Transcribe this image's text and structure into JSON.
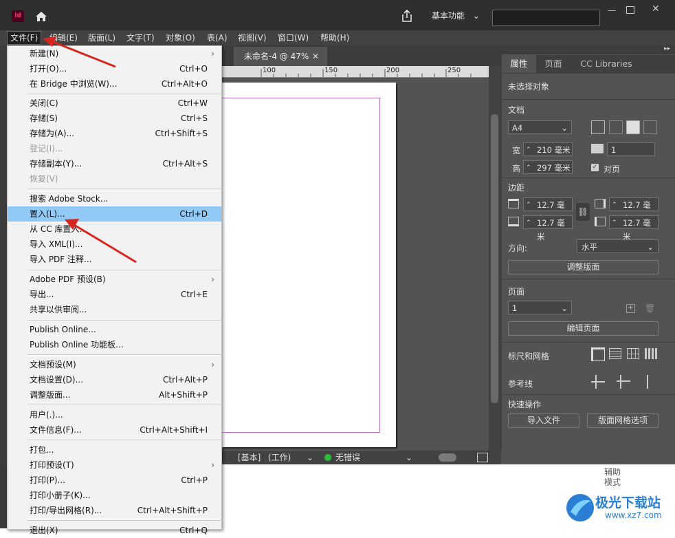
{
  "title_bar": {
    "app_logo": "Id",
    "workspace_label": "基本功能",
    "search_placeholder": ""
  },
  "menus": [
    "文件(F)",
    "编辑(E)",
    "版面(L)",
    "文字(T)",
    "对象(O)",
    "表(A)",
    "视图(V)",
    "窗口(W)",
    "帮助(H)"
  ],
  "file_menu": {
    "items": [
      {
        "label": "新建(N)",
        "shortcut": "",
        "submenu": true
      },
      {
        "label": "打开(O)...",
        "shortcut": "Ctrl+O"
      },
      {
        "label": "在 Bridge 中浏览(W)...",
        "shortcut": "Ctrl+Alt+O"
      },
      {
        "label": "关闭(C)",
        "shortcut": "Ctrl+W"
      },
      {
        "label": "存储(S)",
        "shortcut": "Ctrl+S"
      },
      {
        "label": "存储为(A)...",
        "shortcut": "Ctrl+Shift+S"
      },
      {
        "label": "登记(I)...",
        "shortcut": "",
        "disabled": true
      },
      {
        "label": "存储副本(Y)...",
        "shortcut": "Ctrl+Alt+S"
      },
      {
        "label": "恢复(V)",
        "shortcut": "",
        "disabled": true
      },
      {
        "label": "搜索 Adobe Stock...",
        "shortcut": ""
      },
      {
        "label": "置入(L)...",
        "shortcut": "Ctrl+D",
        "highlight": true
      },
      {
        "label": "从 CC 库置入...",
        "shortcut": ""
      },
      {
        "label": "导入 XML(I)...",
        "shortcut": ""
      },
      {
        "label": "导入 PDF 注释...",
        "shortcut": ""
      },
      {
        "label": "Adobe PDF 预设(B)",
        "shortcut": "",
        "submenu": true
      },
      {
        "label": "导出...",
        "shortcut": "Ctrl+E"
      },
      {
        "label": "共享以供审阅...",
        "shortcut": ""
      },
      {
        "label": "Publish Online...",
        "shortcut": ""
      },
      {
        "label": "Publish Online 功能板...",
        "shortcut": ""
      },
      {
        "label": "文档预设(M)",
        "shortcut": "",
        "submenu": true
      },
      {
        "label": "文档设置(D)...",
        "shortcut": "Ctrl+Alt+P"
      },
      {
        "label": "调整版面...",
        "shortcut": "Alt+Shift+P"
      },
      {
        "label": "用户(.)...",
        "shortcut": ""
      },
      {
        "label": "文件信息(F)...",
        "shortcut": "Ctrl+Alt+Shift+I"
      },
      {
        "label": "打包...",
        "shortcut": ""
      },
      {
        "label": "打印预设(T)",
        "shortcut": "",
        "submenu": true
      },
      {
        "label": "打印(P)...",
        "shortcut": "Ctrl+P"
      },
      {
        "label": "打印小册子(K)...",
        "shortcut": ""
      },
      {
        "label": "打印/导出网格(R)...",
        "shortcut": "Ctrl+Alt+Shift+P"
      },
      {
        "label": "退出(X)",
        "shortcut": "Ctrl+Q"
      }
    ]
  },
  "document_tab": {
    "label": "未命名-4 @ 47%"
  },
  "ruler": {
    "ticks": [
      "100",
      "150",
      "200",
      "250"
    ]
  },
  "status_bar": {
    "style": "[基本]",
    "mode": "(工作)",
    "errors": "无错误"
  },
  "panel": {
    "tabs": [
      "属性",
      "页面",
      "CC Libraries"
    ],
    "no_selection": "未选择对象",
    "document_section": "文档",
    "page_size": "A4",
    "width_label": "宽",
    "width_value": "210 毫米",
    "height_label": "高",
    "height_value": "297 毫米",
    "pages_value": "1",
    "facing_pages": "对页",
    "margins_section": "边距",
    "margin_top": "12.7 毫米",
    "margin_bottom": "12.7 毫米",
    "margin_left": "12.7 毫米",
    "margin_right": "12.7 毫米",
    "orientation_label": "方向:",
    "orientation_value": "水平",
    "adjust_layout_btn": "调整版面",
    "pages_section": "页面",
    "page_number": "1",
    "edit_page_btn": "编辑页面",
    "rulers_grids": "标尺和网格",
    "guides": "参考线",
    "quick_actions": "快速操作",
    "import_file_btn": "导入文件",
    "layout_grid_btn": "版面网格选项"
  },
  "assist_mode": "辅助\n模式",
  "watermark": {
    "brand": "极光下载站",
    "url": "www.xz7.com"
  }
}
